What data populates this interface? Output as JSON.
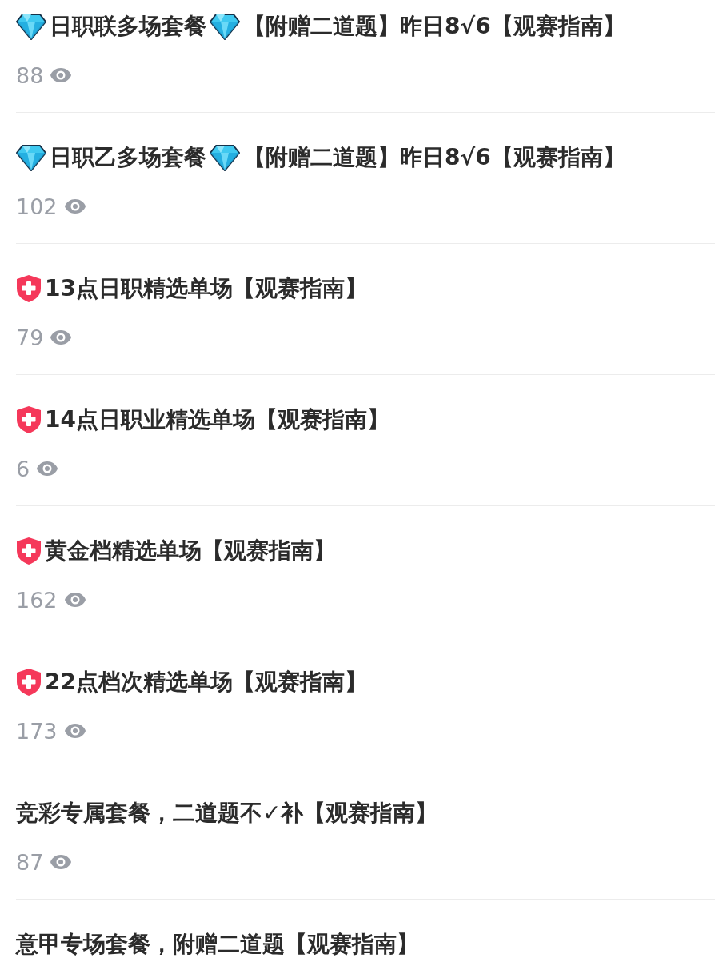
{
  "articles": [
    {
      "title": [
        {
          "kind": "diamond"
        },
        {
          "kind": "text",
          "text": "日职联多场套餐"
        },
        {
          "kind": "diamond"
        },
        {
          "kind": "text",
          "text": "【附赠二道题】昨日8√6【观赛指南】"
        }
      ],
      "views": "88"
    },
    {
      "title": [
        {
          "kind": "diamond"
        },
        {
          "kind": "text",
          "text": "日职乙多场套餐"
        },
        {
          "kind": "diamond"
        },
        {
          "kind": "text",
          "text": "【附赠二道题】昨日8√6【观赛指南】"
        }
      ],
      "views": "102"
    },
    {
      "title": [
        {
          "kind": "shield"
        },
        {
          "kind": "text",
          "text": "13点日职精选单场【观赛指南】"
        }
      ],
      "views": "79"
    },
    {
      "title": [
        {
          "kind": "shield"
        },
        {
          "kind": "text",
          "text": "14点日职业精选单场【观赛指南】"
        }
      ],
      "views": "6"
    },
    {
      "title": [
        {
          "kind": "shield"
        },
        {
          "kind": "text",
          "text": "黄金档精选单场【观赛指南】"
        }
      ],
      "views": "162"
    },
    {
      "title": [
        {
          "kind": "shield"
        },
        {
          "kind": "text",
          "text": "22点档次精选单场【观赛指南】"
        }
      ],
      "views": "173"
    },
    {
      "title": [
        {
          "kind": "text",
          "text": "竞彩专属套餐，二道题不✓补【观赛指南】"
        }
      ],
      "views": "87"
    },
    {
      "title": [
        {
          "kind": "text",
          "text": "意甲专场套餐，附赠二道题【观赛指南】"
        }
      ]
    }
  ]
}
